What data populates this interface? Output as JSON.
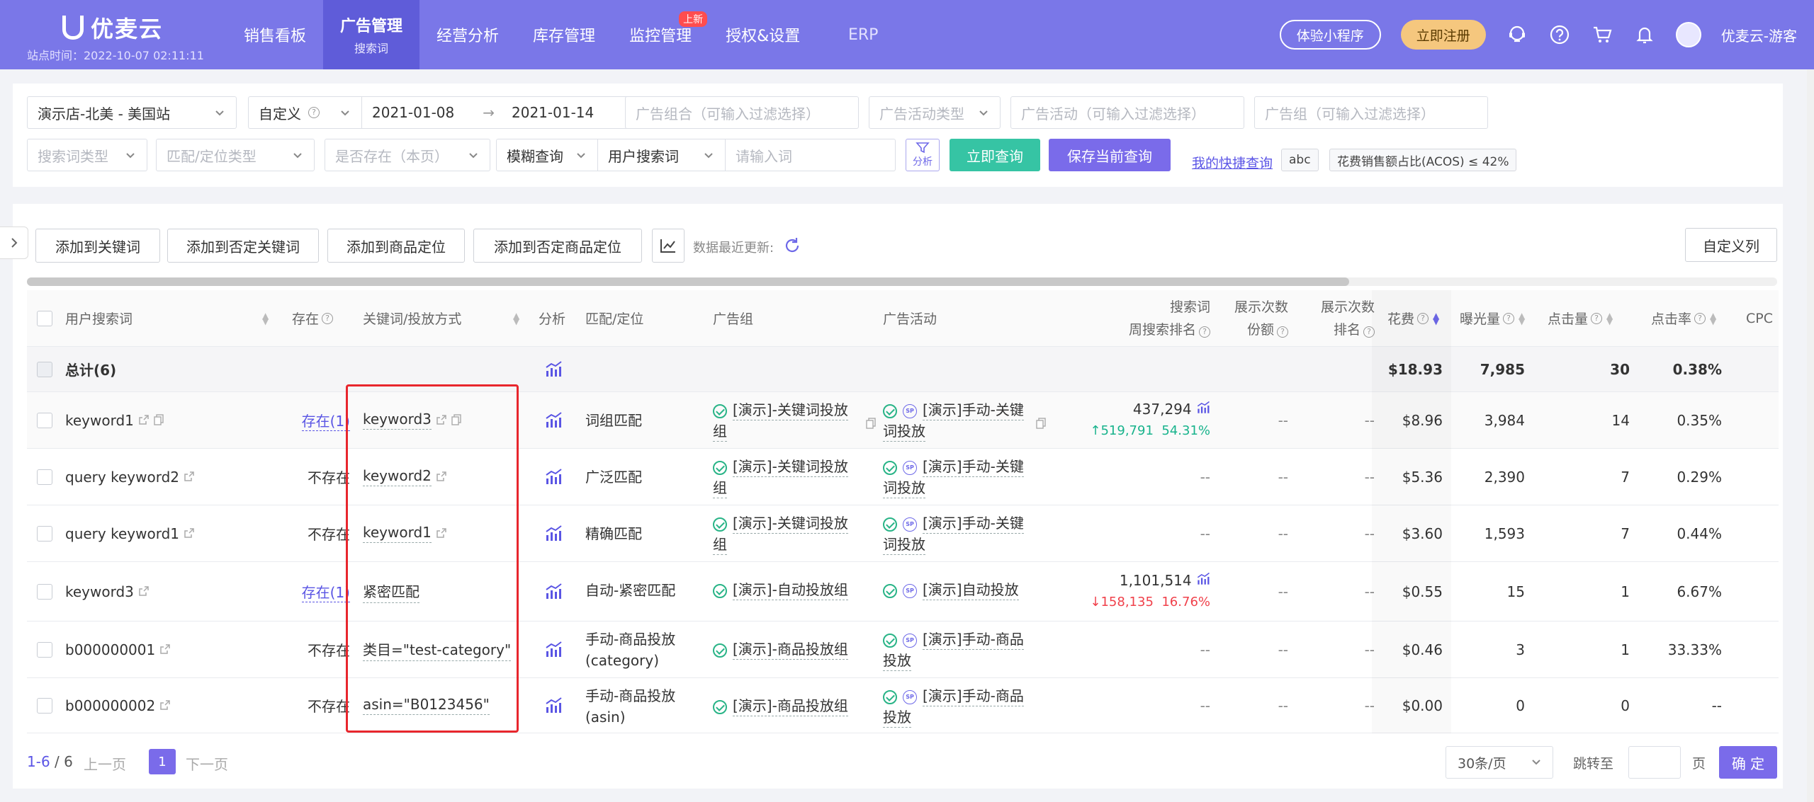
{
  "brand": {
    "name": "优麦云",
    "site_time": "站点时间：2022-10-07 02:11:11"
  },
  "nav": {
    "items": [
      {
        "label": "销售看板"
      },
      {
        "label": "广告管理",
        "sub": "搜索词"
      },
      {
        "label": "经营分析"
      },
      {
        "label": "库存管理"
      },
      {
        "label": "监控管理"
      },
      {
        "label": "授权&设置"
      },
      {
        "label": "ERP"
      }
    ],
    "new_badge": "上新",
    "trial_btn": "体验小程序",
    "register_btn": "立即注册",
    "user": "优麦云-游客"
  },
  "filters": {
    "store": "演示店-北美 - 美国站",
    "date_mode": "自定义",
    "date_start": "2021-01-08",
    "date_end": "2021-01-14",
    "arrow": "→",
    "ad_portfolio": "广告组合（可输入过滤选择）",
    "campaign_type": "广告活动类型",
    "campaign": "广告活动（可输入过滤选择）",
    "ad_group": "广告组（可输入过滤选择）",
    "term_type": "搜索词类型",
    "match_type": "匹配/定位类型",
    "exists": "是否存在（本页）",
    "fuzzy": "模糊查询",
    "search_field": "用户搜索词",
    "keyword_ph": "请输入词",
    "analyze": "分析",
    "query_btn": "立即查询",
    "save_btn": "保存当前查询",
    "quick_link": "我的快捷查询",
    "tag1": "abc",
    "tag2": "花费销售额占比(ACOS) ≤ 42%"
  },
  "toolbar": {
    "add_keyword": "添加到关键词",
    "add_neg_keyword": "添加到否定关键词",
    "add_product": "添加到商品定位",
    "add_neg_product": "添加到否定商品定位",
    "update_text": "数据最近更新:",
    "custom_cols": "自定义列"
  },
  "table": {
    "headers": {
      "term": "用户搜索词",
      "exists": "存在",
      "keyword": "关键词/投放方式",
      "analysis": "分析",
      "match": "匹配/定位",
      "ad_group": "广告组",
      "campaign": "广告活动",
      "rank_l1": "搜索词",
      "rank_l2": "周搜索排名",
      "share_l1": "展示次数",
      "share_l2": "份额",
      "irank_l1": "展示次数",
      "irank_l2": "排名",
      "spend": "花费",
      "impr": "曝光量",
      "clicks": "点击量",
      "ctr": "点击率",
      "cpc": "CPC"
    },
    "total": {
      "label": "总计(6)",
      "spend": "$18.93",
      "impr": "7,985",
      "clicks": "30",
      "ctr": "0.38%"
    },
    "rows": [
      {
        "term": "keyword1",
        "exists": "存在(1)",
        "keyword": "keyword3",
        "match": "词组匹配",
        "ad_group_l1": "[演示]-关键词投放",
        "ad_group_l2": "组",
        "campaign_l1": "[演示]手动-关键",
        "campaign_l2": "词投放",
        "rank": "437,294",
        "rank_change": "519,791",
        "rank_pct": "54.31%",
        "rank_dir": "up",
        "share": "--",
        "irank": "--",
        "spend": "$8.96",
        "impr": "3,984",
        "clicks": "14",
        "ctr": "0.35%"
      },
      {
        "term": "query keyword2",
        "exists": "不存在",
        "keyword": "keyword2",
        "match": "广泛匹配",
        "ad_group_l1": "[演示]-关键词投放",
        "ad_group_l2": "组",
        "campaign_l1": "[演示]手动-关键",
        "campaign_l2": "词投放",
        "rank": "--",
        "share": "--",
        "irank": "--",
        "spend": "$5.36",
        "impr": "2,390",
        "clicks": "7",
        "ctr": "0.29%"
      },
      {
        "term": "query keyword1",
        "exists": "不存在",
        "keyword": "keyword1",
        "match": "精确匹配",
        "ad_group_l1": "[演示]-关键词投放",
        "ad_group_l2": "组",
        "campaign_l1": "[演示]手动-关键",
        "campaign_l2": "词投放",
        "rank": "--",
        "share": "--",
        "irank": "--",
        "spend": "$3.60",
        "impr": "1,593",
        "clicks": "7",
        "ctr": "0.44%"
      },
      {
        "term": "keyword3",
        "exists": "存在(1)",
        "keyword": "紧密匹配",
        "match": "自动-紧密匹配",
        "ad_group_l1": "[演示]-自动投放组",
        "ad_group_l2": "",
        "campaign_l1": "[演示]自动投放",
        "campaign_l2": "",
        "rank": "1,101,514",
        "rank_change": "158,135",
        "rank_pct": "16.76%",
        "rank_dir": "down",
        "share": "--",
        "irank": "--",
        "spend": "$0.55",
        "impr": "15",
        "clicks": "1",
        "ctr": "6.67%"
      },
      {
        "term": "b000000001",
        "exists": "不存在",
        "keyword": "类目=\"test-category\"",
        "match": "手动-商品投放",
        "match_l2": "(category)",
        "ad_group_l1": "[演示]-商品投放组",
        "ad_group_l2": "",
        "campaign_l1": "[演示]手动-商品",
        "campaign_l2": "投放",
        "rank": "--",
        "share": "--",
        "irank": "--",
        "spend": "$0.46",
        "impr": "3",
        "clicks": "1",
        "ctr": "33.33%"
      },
      {
        "term": "b000000002",
        "exists": "不存在",
        "keyword": "asin=\"B0123456\"",
        "match": "手动-商品投放",
        "match_l2": "(asin)",
        "ad_group_l1": "[演示]-商品投放组",
        "ad_group_l2": "",
        "campaign_l1": "[演示]手动-商品",
        "campaign_l2": "投放",
        "rank": "--",
        "share": "--",
        "irank": "--",
        "spend": "$0.00",
        "impr": "0",
        "clicks": "0",
        "ctr": "--"
      }
    ]
  },
  "pager": {
    "range": "1-6",
    "total": "/ 6",
    "prev": "上一页",
    "next": "下一页",
    "current": "1",
    "page_size": "30条/页",
    "jump_to": "跳转至",
    "page_unit": "页",
    "confirm": "确 定"
  },
  "colors": {
    "nav_bg": "#7a77e8",
    "accent": "#7a6bea",
    "green_btn": "#36c4a4",
    "highlight_frame": "#e8262d"
  }
}
